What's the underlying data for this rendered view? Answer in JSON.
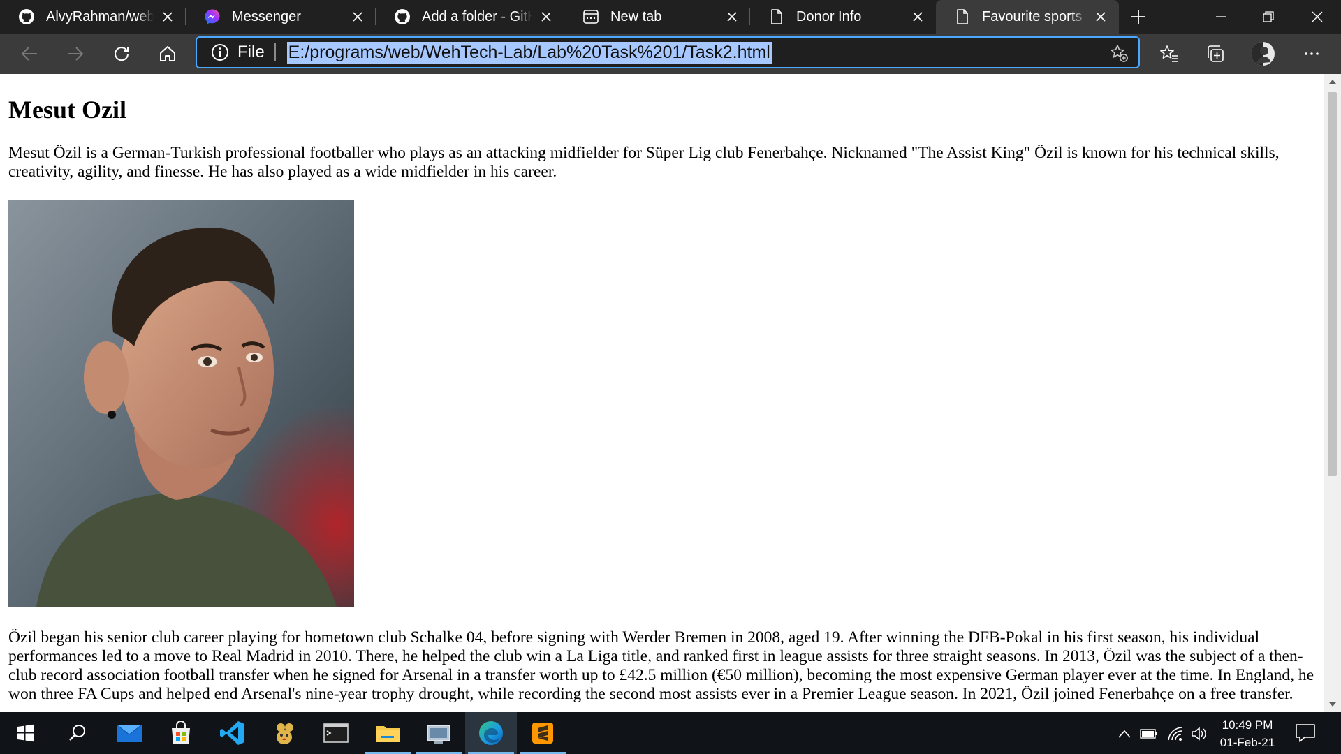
{
  "browser": {
    "tabs": [
      {
        "title": "AlvyRahman/webtech",
        "icon": "github-icon",
        "active": false
      },
      {
        "title": "Messenger",
        "icon": "messenger-icon",
        "active": false
      },
      {
        "title": "Add a folder - GitHub",
        "icon": "github-icon",
        "active": false
      },
      {
        "title": "New tab",
        "icon": "new-tab-page-icon",
        "active": false
      },
      {
        "title": "Donor Info",
        "icon": "page-icon",
        "active": false
      },
      {
        "title": "Favourite sports man",
        "icon": "page-icon",
        "active": true
      }
    ],
    "address": {
      "scheme_label": "File",
      "url": "E:/programs/web/WehTech-Lab/Lab%20Task%201/Task2.html"
    },
    "accent_color": "#4aa8ff",
    "selection_color": "#a6c8ff"
  },
  "page": {
    "heading": "Mesut Ozil",
    "paragraph_1": "Mesut Özil is a German-Turkish professional footballer who plays as an attacking midfielder for Süper Lig club Fenerbahçe. Nicknamed \"The Assist King\" Özil is known for his technical skills, creativity, agility, and finesse. He has also played as a wide midfielder in his career.",
    "paragraph_2": "Özil began his senior club career playing for hometown club Schalke 04, before signing with Werder Bremen in 2008, aged 19. After winning the DFB-Pokal in his first season, his individual performances led to a move to Real Madrid in 2010. There, he helped the club win a La Liga title, and ranked first in league assists for three straight seasons. In 2013, Özil was the subject of a then-club record association football transfer when he signed for Arsenal in a transfer worth up to £42.5 million (€50 million), becoming the most expensive German player ever at the time. In England, he won three FA Cups and helped end Arsenal's nine-year trophy drought, while recording the second most assists ever in a Premier League season. In 2021, Özil joined Fenerbahçe on a free transfer."
  },
  "taskbar": {
    "apps": [
      "windows-start-icon",
      "search-icon",
      "mail-icon",
      "store-icon",
      "vscode-icon",
      "tweeten-icon",
      "terminal-icon",
      "file-explorer-icon",
      "remote-desktop-icon",
      "edge-icon",
      "sublime-text-icon"
    ],
    "time": "10:49 PM",
    "date": "01-Feb-21"
  }
}
